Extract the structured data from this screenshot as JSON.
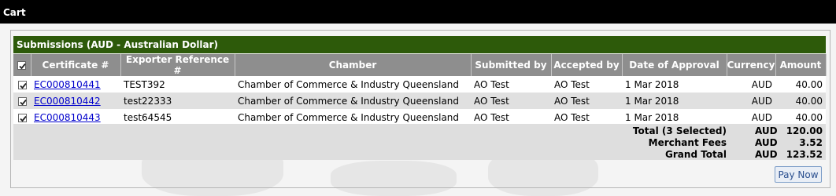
{
  "window": {
    "title": "Cart"
  },
  "section": {
    "title": "Submissions (AUD - Australian Dollar)"
  },
  "table": {
    "columns": [
      "Certificate #",
      "Exporter Reference #",
      "Chamber",
      "Submitted by",
      "Accepted by",
      "Date of Approval",
      "Currency",
      "Amount"
    ],
    "select_all_checked": true,
    "rows": [
      {
        "checked": true,
        "certificate": "EC000810441",
        "exporter_ref": "TEST392",
        "chamber": "Chamber of Commerce & Industry Queensland",
        "submitted_by": "AO Test",
        "accepted_by": "AO Test",
        "date_of_approval": "1 Mar 2018",
        "currency": "AUD",
        "amount": "40.00"
      },
      {
        "checked": true,
        "certificate": "EC000810442",
        "exporter_ref": "test22333",
        "chamber": "Chamber of Commerce & Industry Queensland",
        "submitted_by": "AO Test",
        "accepted_by": "AO Test",
        "date_of_approval": "1 Mar 2018",
        "currency": "AUD",
        "amount": "40.00"
      },
      {
        "checked": true,
        "certificate": "EC000810443",
        "exporter_ref": "test64545",
        "chamber": "Chamber of Commerce & Industry Queensland",
        "submitted_by": "AO Test",
        "accepted_by": "AO Test",
        "date_of_approval": "1 Mar 2018",
        "currency": "AUD",
        "amount": "40.00"
      }
    ]
  },
  "totals": [
    {
      "label": "Total (3 Selected)",
      "currency": "AUD",
      "amount": "120.00"
    },
    {
      "label": "Merchant Fees",
      "currency": "AUD",
      "amount": "3.52"
    },
    {
      "label": "Grand Total",
      "currency": "AUD",
      "amount": "123.52"
    }
  ],
  "actions": {
    "pay_now_label": "Pay Now"
  },
  "colors": {
    "header_green": "#2d5a0a",
    "column_header_gray": "#8e8e8e",
    "link_blue": "#0000cc"
  },
  "icons": {
    "checkbox": "checkmark-icon"
  }
}
